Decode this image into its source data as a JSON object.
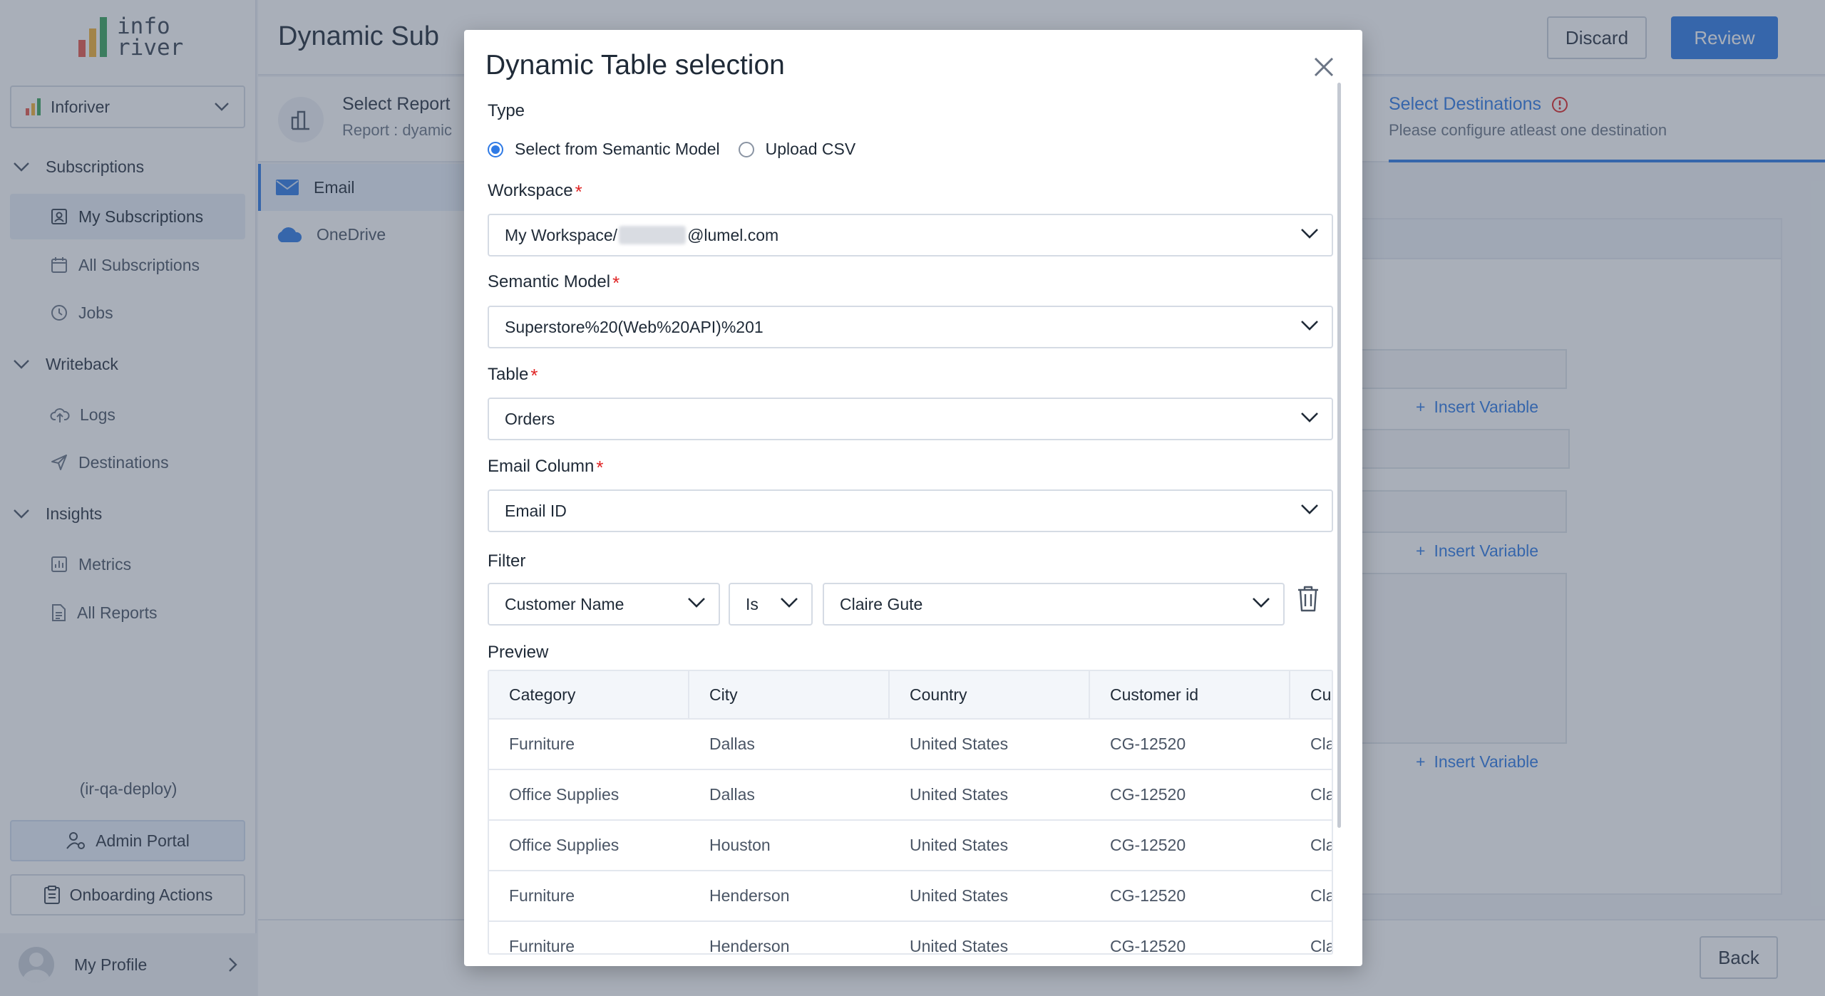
{
  "brand": {
    "line1": "info",
    "line2": "river",
    "bar_colors": [
      "#e8584b",
      "#f2b134",
      "#3aa55c",
      "#2f7ae5"
    ]
  },
  "sidebar": {
    "workspace": "Inforiver",
    "groups": [
      {
        "label": "Subscriptions",
        "items": [
          "My Subscriptions",
          "All Subscriptions",
          "Jobs"
        ]
      },
      {
        "label": "Writeback",
        "items": [
          "Logs",
          "Destinations"
        ]
      },
      {
        "label": "Insights",
        "items": [
          "Metrics",
          "All Reports"
        ]
      }
    ],
    "env": "(ir-qa-deploy)",
    "admin_portal": "Admin Portal",
    "onboarding": "Onboarding Actions",
    "profile": "My Profile"
  },
  "header": {
    "title": "Dynamic Sub",
    "discard": "Discard",
    "review": "Review"
  },
  "steps": {
    "step1_title": "Select Report",
    "step1_sub": "Report : dyamic",
    "step3_title": "Select Destinations",
    "step3_sub": "Please configure atleast one destination"
  },
  "destinations": [
    "Email",
    "OneDrive"
  ],
  "insert_variable": "Insert Variable",
  "back": "Back",
  "modal": {
    "title": "Dynamic Table selection",
    "type_label": "Type",
    "type_options": [
      "Select from Semantic Model",
      "Upload CSV"
    ],
    "type_selected": "Select from Semantic Model",
    "workspace_label": "Workspace",
    "workspace_prefix": "My Workspace/",
    "workspace_suffix": "@lumel.com",
    "semantic_label": "Semantic Model",
    "semantic_value": "Superstore%20(Web%20API)%201",
    "table_label": "Table",
    "table_value": "Orders",
    "email_label": "Email Column",
    "email_value": "Email ID",
    "filter_label": "Filter",
    "filter_field": "Customer Name",
    "filter_op": "Is",
    "filter_value": "Claire Gute",
    "preview_label": "Preview",
    "columns": [
      "Category",
      "City",
      "Country",
      "Customer id",
      "Cu"
    ],
    "rows": [
      [
        "Furniture",
        "Dallas",
        "United States",
        "CG-12520",
        "Cla"
      ],
      [
        "Office Supplies",
        "Dallas",
        "United States",
        "CG-12520",
        "Cla"
      ],
      [
        "Office Supplies",
        "Houston",
        "United States",
        "CG-12520",
        "Cla"
      ],
      [
        "Furniture",
        "Henderson",
        "United States",
        "CG-12520",
        "Cla"
      ],
      [
        "Furniture",
        "Henderson",
        "United States",
        "CG-12520",
        "Cla"
      ]
    ]
  },
  "colors": {
    "accent": "#2f7ae5",
    "required": "#e02424"
  }
}
